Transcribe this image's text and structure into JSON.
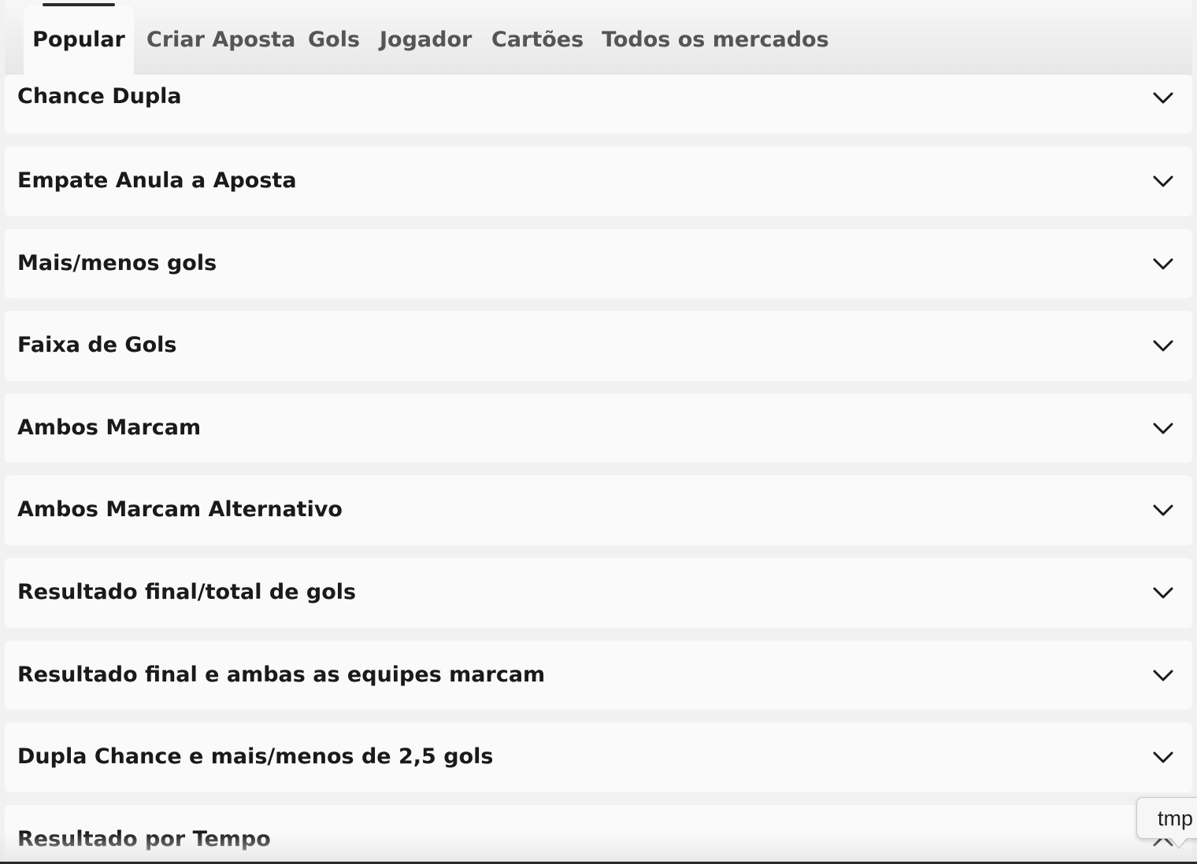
{
  "tabs": [
    {
      "label": "Popular",
      "active": true
    },
    {
      "label": "Criar Aposta",
      "active": false
    },
    {
      "label": "Gols",
      "active": false
    },
    {
      "label": "Jogador",
      "active": false
    },
    {
      "label": "Cartões",
      "active": false
    },
    {
      "label": "Todos os mercados",
      "active": false
    }
  ],
  "markets": [
    {
      "title": "Chance Dupla",
      "expanded": false
    },
    {
      "title": "Empate Anula a Aposta",
      "expanded": false
    },
    {
      "title": "Mais/menos gols",
      "expanded": false
    },
    {
      "title": "Faixa de Gols",
      "expanded": false
    },
    {
      "title": "Ambos Marcam",
      "expanded": false
    },
    {
      "title": "Ambos Marcam Alternativo",
      "expanded": false
    },
    {
      "title": "Resultado final/total de gols",
      "expanded": false
    },
    {
      "title": "Resultado final e ambas as equipes marcam",
      "expanded": false
    },
    {
      "title": "Dupla Chance e mais/menos de 2,5 gols",
      "expanded": false
    },
    {
      "title": "Resultado por Tempo",
      "expanded": true
    }
  ],
  "tooltip": {
    "text": "tmp"
  },
  "icons": {
    "collapsed": "chevron-down-icon",
    "expanded": "chevron-up-icon"
  },
  "colors": {
    "background": "#f1f1f1",
    "card": "#fafafa",
    "text": "#1a1a1a",
    "inactive_tab": "#555555",
    "active_indicator": "#2b2b2b"
  }
}
